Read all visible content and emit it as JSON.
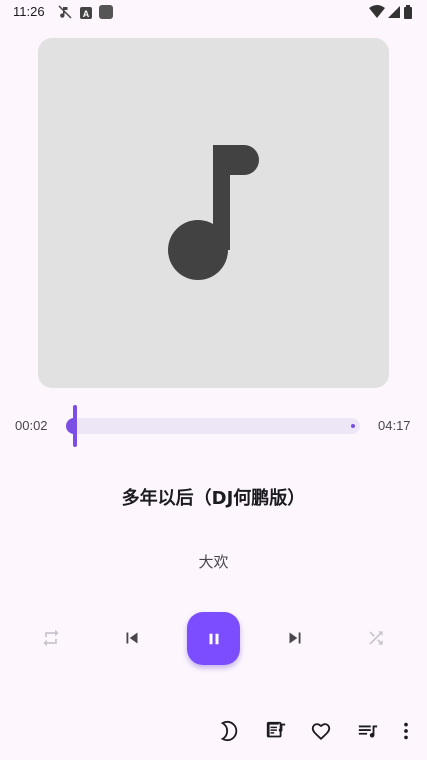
{
  "status_bar": {
    "time": "11:26",
    "icons": [
      "music-note-off-icon",
      "a-icon",
      "square-app-icon",
      "wifi-icon",
      "signal-icon",
      "battery-icon"
    ]
  },
  "player": {
    "album_art_icon": "music-note-icon",
    "elapsed": "00:02",
    "total": "04:17",
    "progress": 0.008,
    "title": "多年以后（DJ何鹏版）",
    "artist": "大欢"
  },
  "controls": {
    "repeat_icon": "repeat-icon",
    "previous_icon": "skip-previous-icon",
    "play_state": "playing",
    "pause_icon": "pause-icon",
    "next_icon": "skip-next-icon",
    "shuffle_icon": "shuffle-icon"
  },
  "bottom_bar": {
    "icons": [
      "sleep-timer-icon",
      "lyrics-icon",
      "favorite-icon",
      "queue-icon",
      "more-icon"
    ]
  },
  "colors": {
    "background": "#fdf7fd",
    "accent": "#7c4dff",
    "album_bg": "#e1e1e1",
    "track": "#ede6f7"
  }
}
